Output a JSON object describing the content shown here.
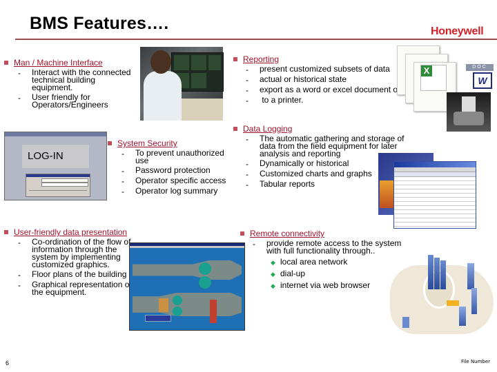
{
  "header": {
    "title": "BMS Features….",
    "logo": "Honeywell"
  },
  "sections": {
    "mmi": {
      "heading": "Man / Machine Interface",
      "items": [
        "Interact with the connected technical building equipment.",
        "User friendly for Operators/Engineers"
      ]
    },
    "reporting": {
      "heading": "Reporting",
      "items": [
        "present customized subsets of data",
        "actual or historical state",
        "export as a word or excel document o",
        " to a printer."
      ]
    },
    "security": {
      "heading": "System Security",
      "items": [
        "To prevent unauthorized use",
        "Password protection",
        "Operator specific access",
        "Operator log summary"
      ]
    },
    "logging": {
      "heading": "Data Logging",
      "items": [
        "The automatic gathering and storage of data from the field equipment for later analysis and reporting",
        "Dynamically or historical",
        "Customized charts and graphs",
        "Tabular reports"
      ]
    },
    "presentation": {
      "heading": "User-friendly data presentation",
      "items": [
        "Co-ordination of the flow of information through the system by implementing customized graphics.",
        "Floor plans of the building",
        "Graphical representation of the equipment."
      ]
    },
    "remote": {
      "heading": "Remote connectivity",
      "items": [
        "provide remote access to the system with full functionality through.."
      ],
      "subitems": [
        "local area network",
        "dial-up",
        "internet via web browser"
      ]
    }
  },
  "images": {
    "login_label": "LOG-IN",
    "doc_label": "DOC"
  },
  "footer": {
    "page_number": "6",
    "file_number": "File Number"
  }
}
